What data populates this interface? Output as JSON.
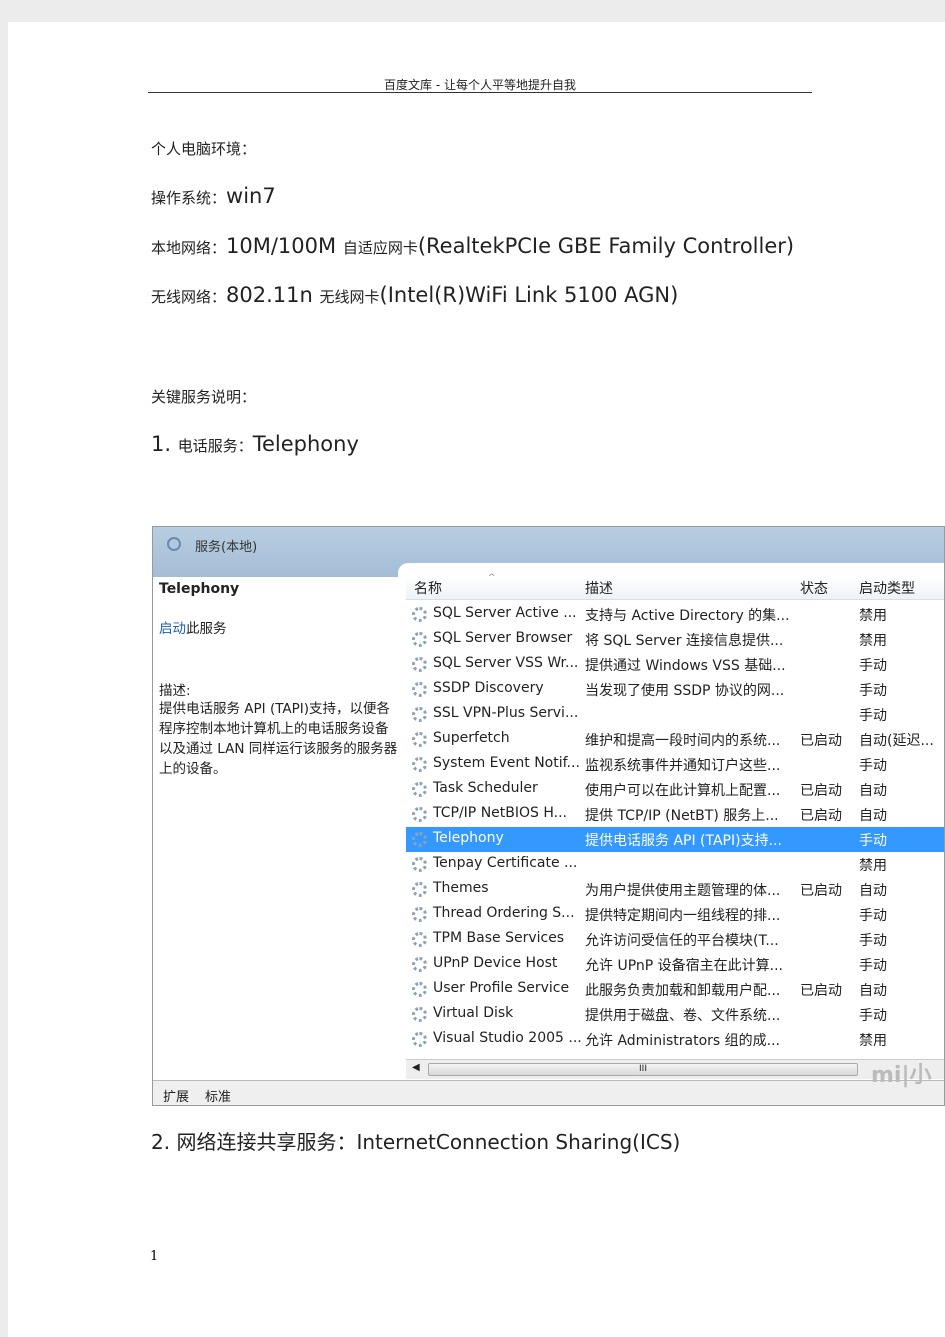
{
  "header": "百度文库 - 让每个人平等地提升自我",
  "lines": {
    "env_title": "个人电脑环境：",
    "os_label": "操作系统：",
    "os_value": "win7",
    "lan_label": "本地网络：",
    "lan_value1": "10M/100M ",
    "lan_small": "自适应网卡",
    "lan_value2": "(RealtekPCIe  GBE  Family  Controller)",
    "wlan_label": "无线网络：",
    "wlan_value1": "802.11n ",
    "wlan_small": "无线网卡",
    "wlan_value2": "(Intel(R)WiFi  Link  5100  AGN)",
    "services_title": "关键服务说明：",
    "item1_num": "1. ",
    "item1_label": "电话服务：",
    "item1_value": "Telephony",
    "item2": "2.  网络连接共享服务：InternetConnection  Sharing(ICS)"
  },
  "screenshot": {
    "title": "服务(本地)",
    "selected_name": "Telephony",
    "start_link": "启动",
    "start_rest": "此服务",
    "desc_label": "描述:",
    "desc_text": "提供电话服务 API (TAPI)支持，以便各程序控制本地计算机上的电话服务设备以及通过 LAN 同样运行该服务的服务器上的设备。",
    "columns": [
      "名称",
      "描述",
      "状态",
      "启动类型"
    ],
    "rows": [
      {
        "name": "SQL Server Active ...",
        "desc": "支持与 Active Directory 的集...",
        "status": "",
        "startup": "禁用"
      },
      {
        "name": "SQL Server Browser",
        "desc": "将 SQL Server 连接信息提供...",
        "status": "",
        "startup": "禁用"
      },
      {
        "name": "SQL Server VSS Wr...",
        "desc": "提供通过 Windows VSS 基础...",
        "status": "",
        "startup": "手动"
      },
      {
        "name": "SSDP Discovery",
        "desc": "当发现了使用 SSDP 协议的网...",
        "status": "",
        "startup": "手动"
      },
      {
        "name": "SSL VPN-Plus Servi...",
        "desc": "",
        "status": "",
        "startup": "手动"
      },
      {
        "name": "Superfetch",
        "desc": "维护和提高一段时间内的系统...",
        "status": "已启动",
        "startup": "自动(延迟..."
      },
      {
        "name": "System Event Notif...",
        "desc": "监视系统事件并通知订户这些...",
        "status": "",
        "startup": "手动"
      },
      {
        "name": "Task Scheduler",
        "desc": "使用户可以在此计算机上配置...",
        "status": "已启动",
        "startup": "自动"
      },
      {
        "name": "TCP/IP NetBIOS H...",
        "desc": "提供 TCP/IP (NetBT) 服务上...",
        "status": "已启动",
        "startup": "自动"
      },
      {
        "name": "Telephony",
        "desc": "提供电话服务 API (TAPI)支持...",
        "status": "",
        "startup": "手动"
      },
      {
        "name": "Tenpay Certificate ...",
        "desc": "",
        "status": "",
        "startup": "禁用"
      },
      {
        "name": "Themes",
        "desc": "为用户提供使用主题管理的体...",
        "status": "已启动",
        "startup": "自动"
      },
      {
        "name": "Thread Ordering S...",
        "desc": "提供特定期间内一组线程的排...",
        "status": "",
        "startup": "手动"
      },
      {
        "name": "TPM Base Services",
        "desc": "允许访问受信任的平台模块(T...",
        "status": "",
        "startup": "手动"
      },
      {
        "name": "UPnP Device Host",
        "desc": "允许 UPnP 设备宿主在此计算...",
        "status": "",
        "startup": "手动"
      },
      {
        "name": "User Profile Service",
        "desc": "此服务负责加载和卸载用户配...",
        "status": "已启动",
        "startup": "自动"
      },
      {
        "name": "Virtual Disk",
        "desc": "提供用于磁盘、卷、文件系统...",
        "status": "",
        "startup": "手动"
      },
      {
        "name": "Visual Studio 2005 ...",
        "desc": "允许 Administrators 组的成...",
        "status": "",
        "startup": "禁用"
      }
    ],
    "selected_index": 9,
    "tabs": [
      "扩展",
      "标准"
    ],
    "watermark": "mi|小米"
  },
  "page_number": "1"
}
